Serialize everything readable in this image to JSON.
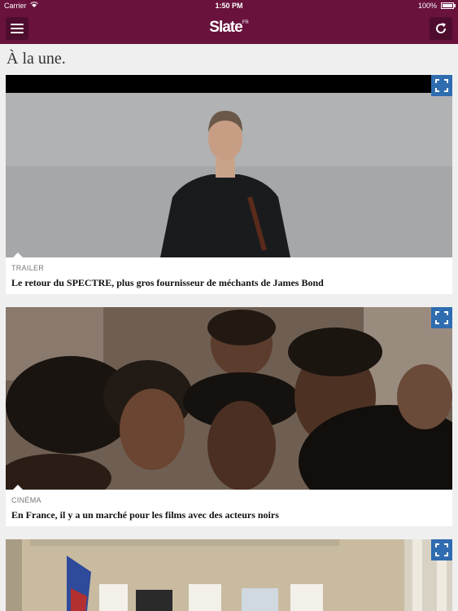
{
  "status_bar": {
    "carrier": "Carrier",
    "time": "1:50 PM",
    "battery": "100%"
  },
  "nav": {
    "logo": "Slate",
    "logo_suffix": "FR",
    "menu_icon": "hamburger-menu-icon",
    "refresh_icon": "refresh-icon"
  },
  "section": {
    "title": "À la une."
  },
  "articles": [
    {
      "category": "Trailer",
      "headline": "Le retour du SPECTRE, plus gros fournisseur de méchants de James Bond",
      "image": "man-in-black-turtleneck-photo"
    },
    {
      "category": "Cinéma",
      "headline": "En France, il y a un marché pour les films avec des acteurs noirs",
      "image": "crowd-of-young-people-photo"
    },
    {
      "category": "",
      "headline": "",
      "image": "building-facade-with-flag-photo"
    }
  ],
  "colors": {
    "brand": "#68123c",
    "expand_button": "#2f6cb0",
    "background": "#efefef"
  }
}
